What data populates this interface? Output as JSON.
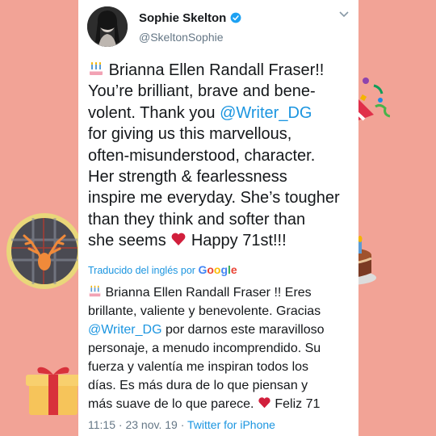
{
  "author": {
    "name": "Sophie Skelton",
    "handle": "@SkeltonSophie"
  },
  "tweet_lines": [
    {
      "emoji": "cake-icon",
      "pre": "Brianna Ellen Randall Fraser!!"
    },
    {
      "pre": "You’re brilliant, brave and bene-"
    },
    {
      "pre": "volent. Thank you ",
      "mention": "@Writer_DG"
    },
    {
      "pre": "for giving us this marvellous,"
    },
    {
      "pre": "often-misunderstood, character."
    },
    {
      "pre": "Her strength & fearlessness"
    },
    {
      "pre": "inspire me everyday. She’s tougher"
    },
    {
      "pre": "than they think and softer than"
    },
    {
      "pre": "she seems ",
      "heart": true,
      "post": " Happy 71st!!!"
    }
  ],
  "translation": {
    "label_prefix": "Traducido del inglés por",
    "label_brand": "Google",
    "lines": [
      {
        "emoji": "cake-icon",
        "pre": "Brianna Ellen Randall Fraser !! Eres"
      },
      {
        "pre": "brillante, valiente y benevolente. Gracias"
      },
      {
        "mention": "@Writer_DG",
        "post": " por darnos este maravilloso"
      },
      {
        "pre": "personaje, a menudo incomprendido. Su"
      },
      {
        "pre": "fuerza y valentía me inspiran todos los"
      },
      {
        "pre": "días. Es más dura de lo que piensan y"
      },
      {
        "pre": "más suave de lo que parece. ",
        "heart": true,
        "post": " Feliz 71"
      }
    ]
  },
  "meta": {
    "time": "11:15",
    "sep": " · ",
    "date": "23 nov. 19",
    "client": "Twitter for iPhone"
  },
  "colors": {
    "background": "#f2a396",
    "link": "#1b95e0",
    "heart": "#d11f3c"
  }
}
